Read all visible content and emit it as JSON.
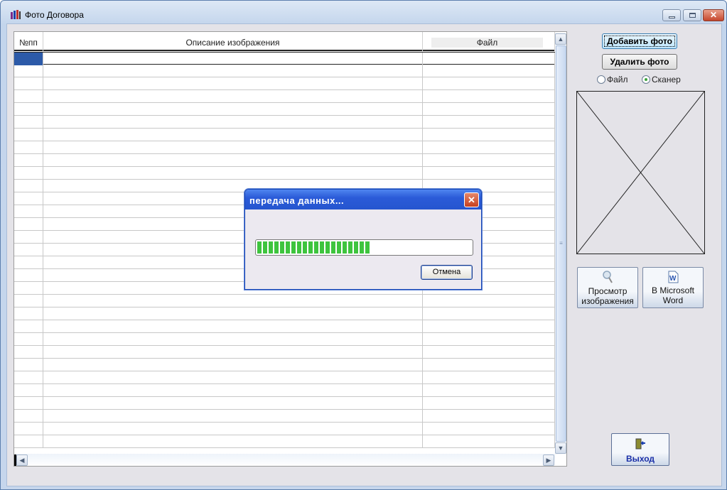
{
  "window": {
    "title": "Фото Договора",
    "icon": "books-icon"
  },
  "table": {
    "columns": [
      "№пп",
      "Описание изображения",
      "Файл"
    ],
    "row_count": 31
  },
  "buttons": {
    "add_photo": "Добавить фото",
    "delete_photo": "Удалить фото",
    "view_image": "Просмотр изображения",
    "to_word": "В Microsoft Word",
    "exit": "Выход"
  },
  "source": {
    "options": [
      "Файл",
      "Сканер"
    ],
    "selected": "Сканер"
  },
  "dialog": {
    "title": "передача данных...",
    "progress_percent": 53,
    "cancel": "Отмена"
  }
}
